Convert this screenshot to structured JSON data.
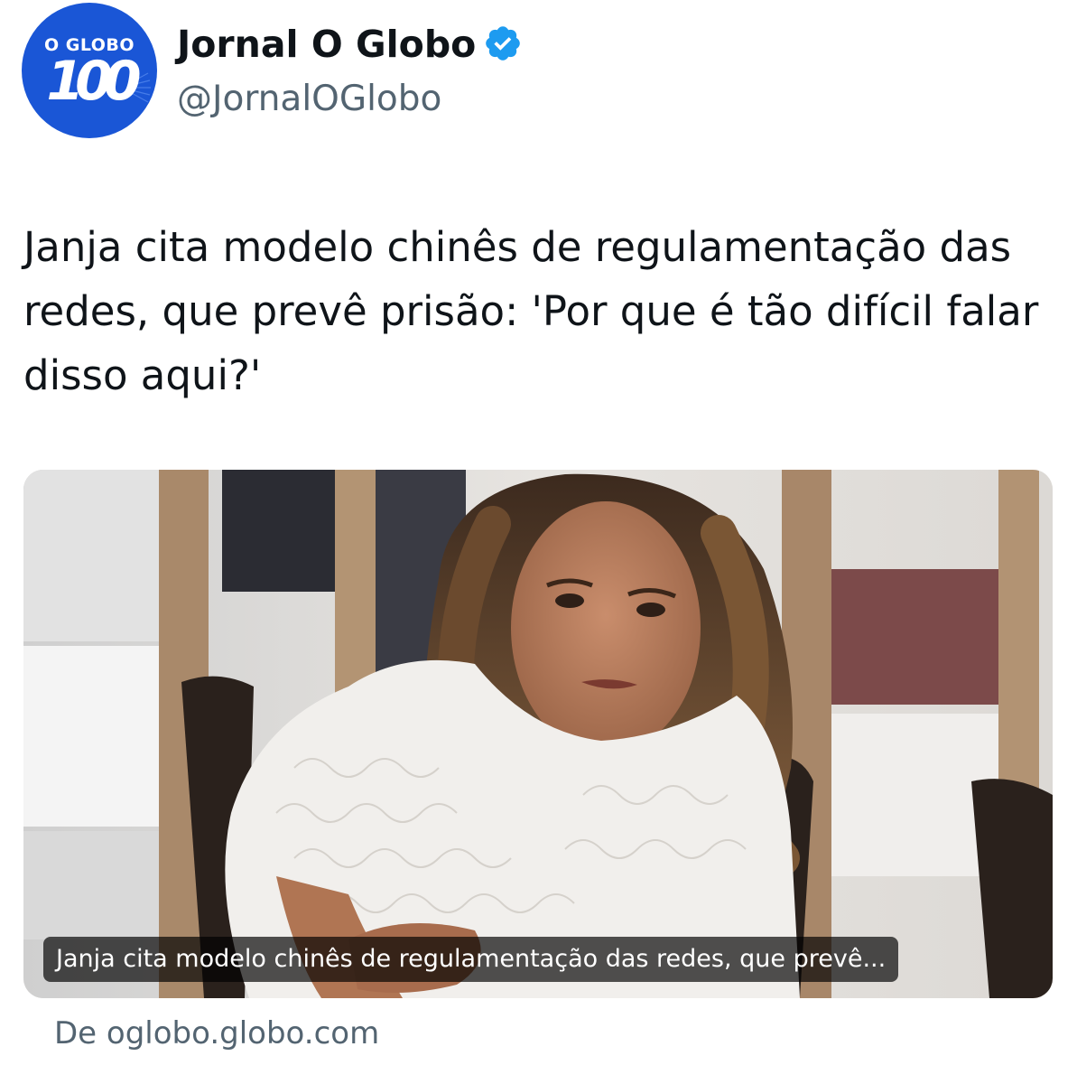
{
  "author": {
    "avatar_text": "O GLOBO",
    "avatar_number": "100",
    "display_name": "Jornal O Globo",
    "handle": "@JornalOGlobo",
    "verified": true,
    "avatar_color": "#1a56d6",
    "verified_color": "#1d9bf0"
  },
  "tweet": {
    "text": "Janja cita modelo chinês de regulamentação das redes, que prevê prisão: 'Por que é tão difícil falar disso aqui?'"
  },
  "card": {
    "caption": "Janja cita modelo chinês de regulamentação das redes, que prevê...",
    "source_prefix": "De",
    "source_domain": "oglobo.globo.com"
  }
}
